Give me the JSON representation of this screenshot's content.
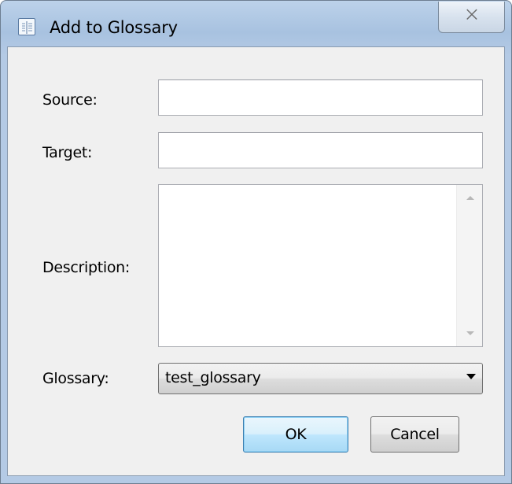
{
  "window": {
    "title": "Add to Glossary",
    "icon": "glossary-book-icon",
    "close_glyph": "⨉"
  },
  "form": {
    "source": {
      "label": "Source:",
      "value": ""
    },
    "target": {
      "label": "Target:",
      "value": ""
    },
    "description": {
      "label": "Description:",
      "value": ""
    },
    "glossary": {
      "label": "Glossary:",
      "selected": "test_glossary"
    }
  },
  "buttons": {
    "ok_label": "OK",
    "cancel_label": "Cancel"
  },
  "colors": {
    "frame": "#b4cae5",
    "client": "#f0f0f0",
    "default_button_border": "#3c7fb1"
  }
}
